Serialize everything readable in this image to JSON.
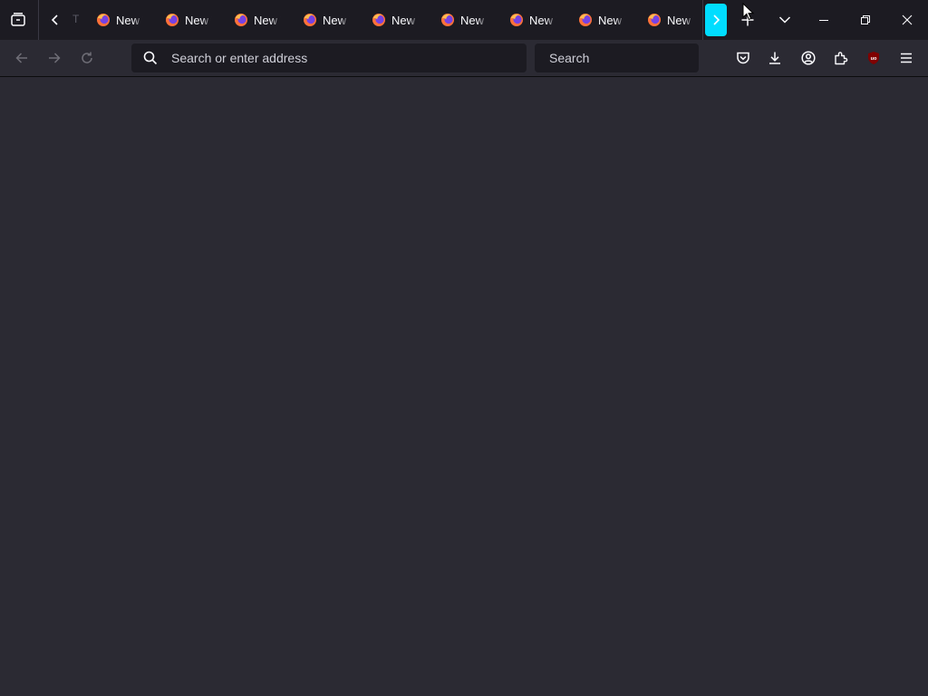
{
  "colors": {
    "tabbar_bg": "#1c1b22",
    "toolbar_bg": "#2b2a33",
    "accent": "#00ddff",
    "text": "#fbfbfe",
    "ublock_badge": "#800000"
  },
  "tabs": [
    {
      "title": "New T",
      "icon": "firefox-icon"
    },
    {
      "title": "New T",
      "icon": "firefox-icon"
    },
    {
      "title": "New T",
      "icon": "firefox-icon"
    },
    {
      "title": "New T",
      "icon": "firefox-icon"
    },
    {
      "title": "New T",
      "icon": "firefox-icon"
    },
    {
      "title": "New T",
      "icon": "firefox-icon"
    },
    {
      "title": "New T",
      "icon": "firefox-icon"
    },
    {
      "title": "New T",
      "icon": "firefox-icon"
    },
    {
      "title": "New T",
      "icon": "firefox-icon"
    }
  ],
  "partial_tab_text": "T",
  "urlbar": {
    "placeholder": "Search or enter address",
    "value": ""
  },
  "searchbar": {
    "placeholder": "Search",
    "value": ""
  },
  "icons": {
    "tab_manager": "tab-manager-icon",
    "scroll_left": "chevron-left-icon",
    "scroll_right": "chevron-right-icon",
    "new_tab": "plus-icon",
    "list_all_tabs": "chevron-down-icon",
    "minimize": "minimize-icon",
    "restore": "restore-icon",
    "close": "close-icon",
    "back": "back-arrow-icon",
    "forward": "forward-arrow-icon",
    "reload": "reload-icon",
    "pocket": "pocket-icon",
    "downloads": "download-icon",
    "account": "account-icon",
    "extensions": "extensions-icon",
    "ublock": "ublock-origin-icon",
    "menu": "hamburger-menu-icon"
  },
  "ublock_badge_text": "uo"
}
